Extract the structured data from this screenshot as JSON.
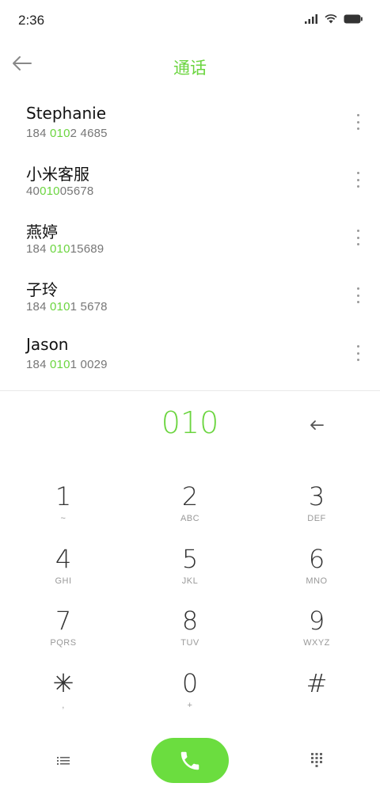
{
  "status_bar": {
    "time": "2:36"
  },
  "header": {
    "title": "通话"
  },
  "contacts": [
    {
      "name": "Stephanie",
      "number_pre": "184 ",
      "number_match": "010",
      "number_post": "2 4685"
    },
    {
      "name": "小米客服",
      "number_pre": "40",
      "number_match": "010",
      "number_post": "05678"
    },
    {
      "name": "燕婷",
      "number_pre": "184 ",
      "number_match": "010",
      "number_post": "15689"
    },
    {
      "name": "子玲",
      "number_pre": "184 ",
      "number_match": "010",
      "number_post": "1 5678"
    },
    {
      "name": "Jason",
      "number_pre": "184 ",
      "number_match": "010",
      "number_post": "1 0029"
    }
  ],
  "dial_input": "010",
  "keypad": [
    {
      "digit": "1",
      "letters": "~"
    },
    {
      "digit": "2",
      "letters": "ABC"
    },
    {
      "digit": "3",
      "letters": "DEF"
    },
    {
      "digit": "4",
      "letters": "GHI"
    },
    {
      "digit": "5",
      "letters": "JKL"
    },
    {
      "digit": "6",
      "letters": "MNO"
    },
    {
      "digit": "7",
      "letters": "PQRS"
    },
    {
      "digit": "8",
      "letters": "TUV"
    },
    {
      "digit": "9",
      "letters": "WXYZ"
    },
    {
      "digit": "✳",
      "letters": ","
    },
    {
      "digit": "0",
      "letters": "+"
    },
    {
      "digit": "#",
      "letters": ""
    }
  ],
  "icons": {
    "back": "arrow-left-icon",
    "more": "more-vertical-icon",
    "delete": "backspace-arrow-icon",
    "menu": "list-icon",
    "call": "phone-icon",
    "dialpad": "dialpad-icon"
  },
  "colors": {
    "accent": "#6bd53f",
    "call_button": "#6bdd3f"
  }
}
